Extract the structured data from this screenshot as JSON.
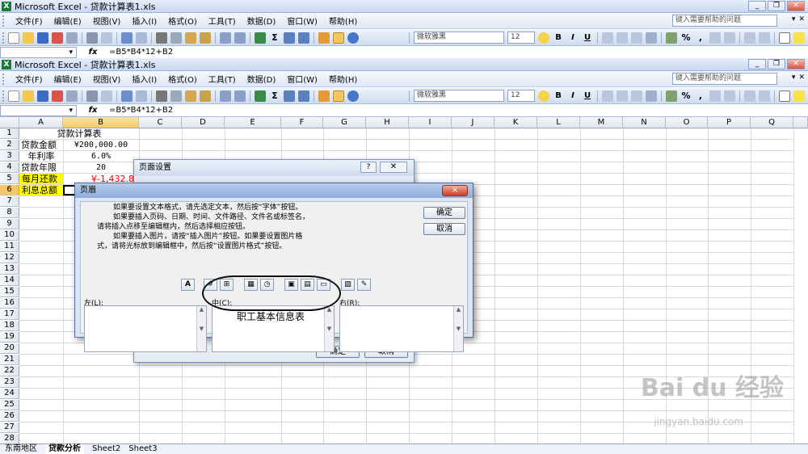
{
  "outer_title": "Microsoft Excel - 贷款计算表1.xls",
  "inner_title": "Microsoft Excel - 贷款计算表1.xls",
  "menu": [
    "文件(F)",
    "编辑(E)",
    "视图(V)",
    "插入(I)",
    "格式(O)",
    "工具(T)",
    "数据(D)",
    "窗口(W)",
    "帮助(H)"
  ],
  "help_placeholder": "键入需要帮助的问题",
  "font_name": "微软雅黑",
  "font_size": "12",
  "formula": "=B5*B4*12+B2",
  "fx_label": "fx",
  "columns": [
    "A",
    "B",
    "C",
    "D",
    "E",
    "F",
    "G",
    "H",
    "I",
    "J",
    "K",
    "L",
    "M",
    "N",
    "O",
    "P",
    "Q"
  ],
  "rows": [
    "1",
    "2",
    "3",
    "4",
    "5",
    "6",
    "7",
    "8",
    "9",
    "10",
    "11",
    "12",
    "13",
    "14",
    "15",
    "16",
    "17",
    "18",
    "19",
    "20",
    "21",
    "22",
    "23",
    "24",
    "25",
    "26",
    "27",
    "28"
  ],
  "cells": {
    "a1": "贷款计算表",
    "a2": "贷款金额",
    "b2": "¥200,000.00",
    "a3": "年利率",
    "b3": "6.0%",
    "a4": "贷款年限",
    "b4": "20",
    "a5": "每月还款",
    "b5": "¥-1,432.8",
    "a6": "利息总额"
  },
  "sheet_tabs": [
    "东南地区",
    "贷款分析",
    "Sheet2",
    "Sheet3"
  ],
  "page_setup": {
    "title": "页面设置",
    "ok": "确定",
    "cancel": "取消"
  },
  "header_dialog": {
    "title": "页眉",
    "close": "×",
    "instructions": [
      "如果要设置文本格式，请先选定文本，然后按“字体”按钮。",
      "如果要插入页码、日期、时间、文件路径、文件名或标签名，",
      "请将插入点移至编辑框内，然后选择相应按钮。",
      "如果要插入图片，请按“插入图片”按钮。如果要设置图片格",
      "式，请将光标放到编辑框中，然后按“设置图片格式”按钮。"
    ],
    "ok": "确定",
    "cancel": "取消",
    "left_label": "左(L):",
    "center_label": "中(C):",
    "right_label": "右(R):",
    "center_text": "职工基本信息表"
  },
  "watermark": "Bai du 经验",
  "watermark_url": "jingyan.baidu.com",
  "colors": {
    "highlight_yellow": "#ffff00",
    "negative_red": "#ff0000",
    "selection_orange": "#f4c86a"
  }
}
